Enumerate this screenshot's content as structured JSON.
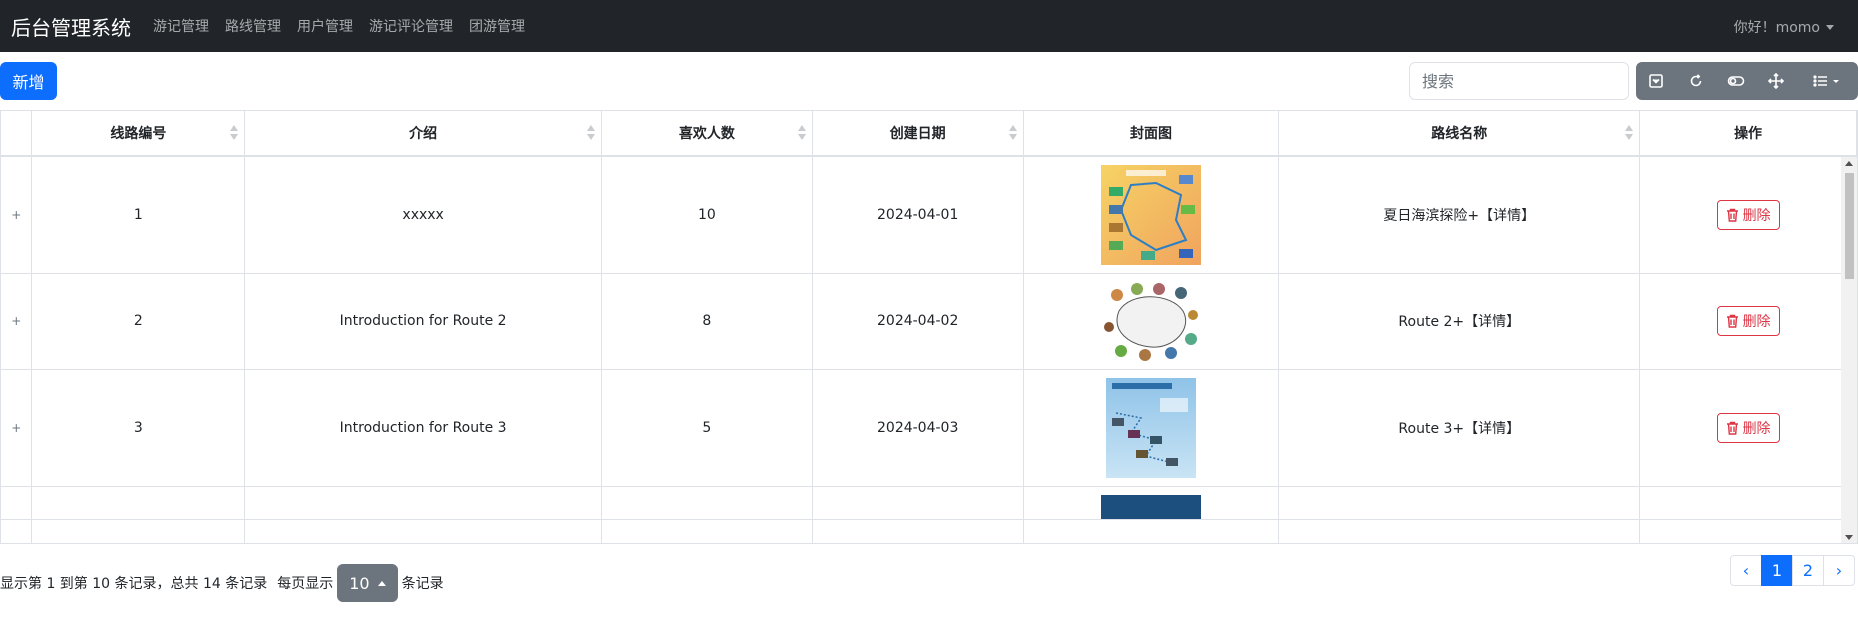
{
  "navbar": {
    "brand": "后台管理系统",
    "links": [
      "游记管理",
      "路线管理",
      "用户管理",
      "游记评论管理",
      "团游管理"
    ],
    "user_greeting": "你好！momo"
  },
  "toolbar": {
    "add_label": "新增",
    "search_placeholder": "搜索",
    "tool_icons": [
      "toggle-view-icon",
      "refresh-icon",
      "toggle-icon",
      "fullscreen-icon",
      "columns-icon"
    ]
  },
  "table": {
    "headers": [
      "线路编号",
      "介绍",
      "喜欢人数",
      "创建日期",
      "封面图",
      "路线名称",
      "操作"
    ],
    "expand_symbol": "+",
    "delete_label": "删除",
    "rows": [
      {
        "id": "1",
        "intro": "xxxxx",
        "likes": "10",
        "date": "2024-04-01",
        "name": "夏日海滨探险+【详情】",
        "cover_icon": "map-cover-image"
      },
      {
        "id": "2",
        "intro": "Introduction for Route 2",
        "likes": "8",
        "date": "2024-04-02",
        "name": "Route 2+【详情】",
        "cover_icon": "route-loop-image"
      },
      {
        "id": "3",
        "intro": "Introduction for Route 3",
        "likes": "5",
        "date": "2024-04-03",
        "name": "Route 3+【详情】",
        "cover_icon": "itinerary-poster-image"
      }
    ]
  },
  "footer": {
    "info_prefix": "显示第 1 到第 10 条记录，总共 14 条记录",
    "per_page_label": "每页显示",
    "page_size": "10",
    "per_page_suffix": "条记录",
    "pages": [
      "‹",
      "1",
      "2",
      "›"
    ]
  },
  "colors": {
    "navbar_bg": "#212529",
    "primary": "#0d6efd",
    "secondary": "#6c757d",
    "danger": "#dc3545"
  }
}
